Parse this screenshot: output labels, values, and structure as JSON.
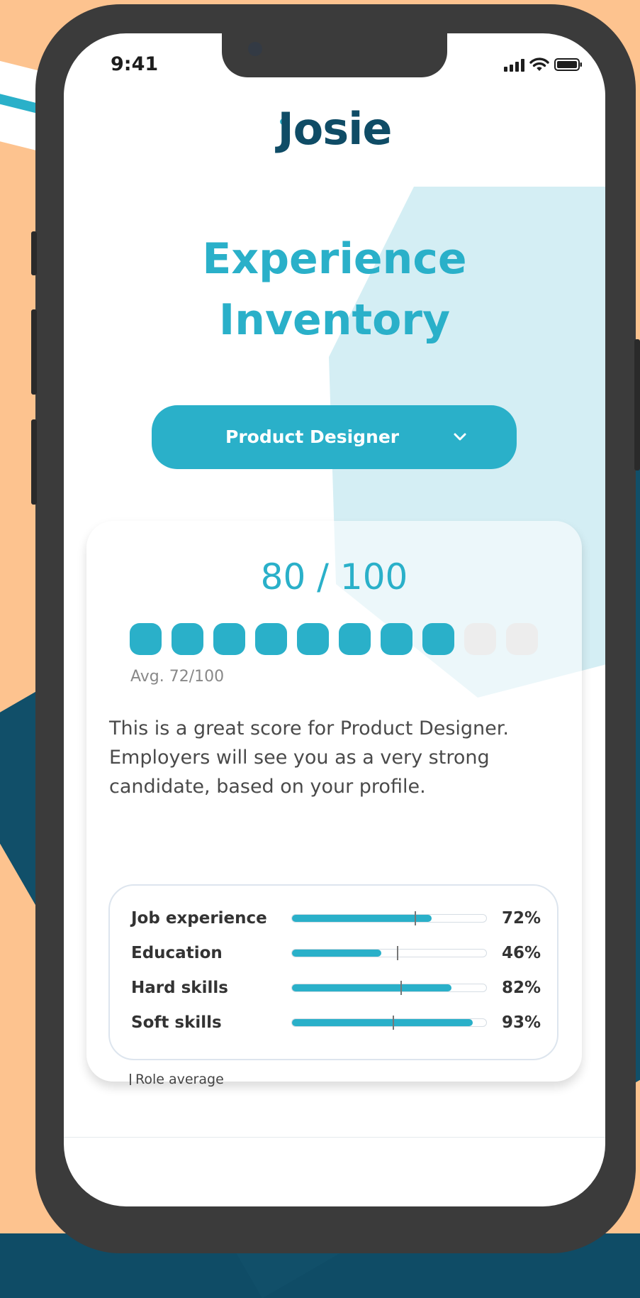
{
  "status_bar": {
    "time": "9:41"
  },
  "brand": {
    "logo_text": "Josie"
  },
  "title": {
    "line1": "Experience",
    "line2": "Inventory"
  },
  "role_select": {
    "value": "Product Designer",
    "icon": "chevron-down-icon"
  },
  "score": {
    "text": "80 / 100",
    "value": 80,
    "max": 100,
    "filled_dots": 8,
    "total_dots": 10,
    "average_text": "Avg. 72/100"
  },
  "description": "This is a great score for Product Designer. Employers will see you as a very strong candidate, based on your profile.",
  "metrics": [
    {
      "label": "Job experience",
      "value_text": "72%",
      "value": 0.72,
      "role_avg": 0.63
    },
    {
      "label": "Education",
      "value_text": "46%",
      "value": 0.46,
      "role_avg": 0.54
    },
    {
      "label": "Hard skills",
      "value_text": "82%",
      "value": 0.82,
      "role_avg": 0.56
    },
    {
      "label": "Soft skills",
      "value_text": "93%",
      "value": 0.93,
      "role_avg": 0.52
    }
  ],
  "legend": {
    "label": "Role average"
  },
  "colors": {
    "accent": "#2ab0c9",
    "brand_dark": "#0f4c66",
    "dot_empty": "#ededed",
    "backdrop_peach": "#fdc38f",
    "backdrop_navy": "#114f69"
  }
}
